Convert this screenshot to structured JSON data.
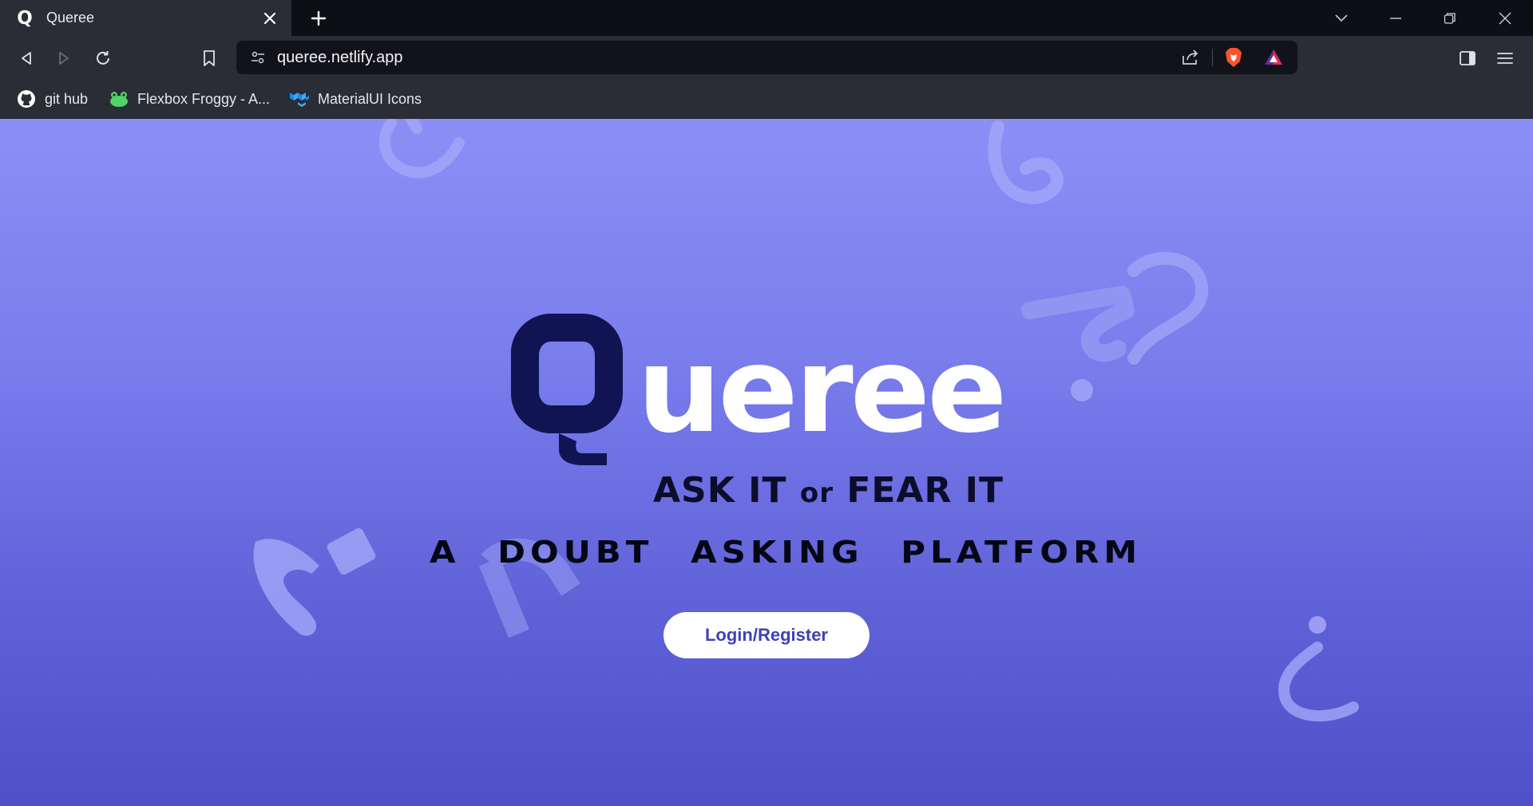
{
  "browser": {
    "tab": {
      "title": "Queree",
      "favicon": "Q"
    },
    "url": "queree.netlify.app",
    "bookmarks": [
      {
        "label": "git hub",
        "icon": "github-icon"
      },
      {
        "label": "Flexbox Froggy - A...",
        "icon": "frog-icon"
      },
      {
        "label": "MaterialUI Icons",
        "icon": "mui-icon"
      }
    ],
    "colors": {
      "tabstrip": "#0e0f14",
      "toolbar": "#2a2c36",
      "urlbar": "#12131a"
    }
  },
  "hero": {
    "logo_first_letter": "Q",
    "logo_rest": "ueree",
    "tagline_part1": "ASK IT ",
    "tagline_or": "or",
    "tagline_part2": " FEAR IT",
    "subtitle": "A DOUBT ASKING PLATFORM",
    "cta_label": "Login/Register"
  },
  "colors": {
    "page_top": "#8b8ff5",
    "page_bottom": "#4f50c8",
    "logo_dark": "#111452",
    "logo_light": "#ffffff",
    "cta_text": "#3f42b6"
  }
}
